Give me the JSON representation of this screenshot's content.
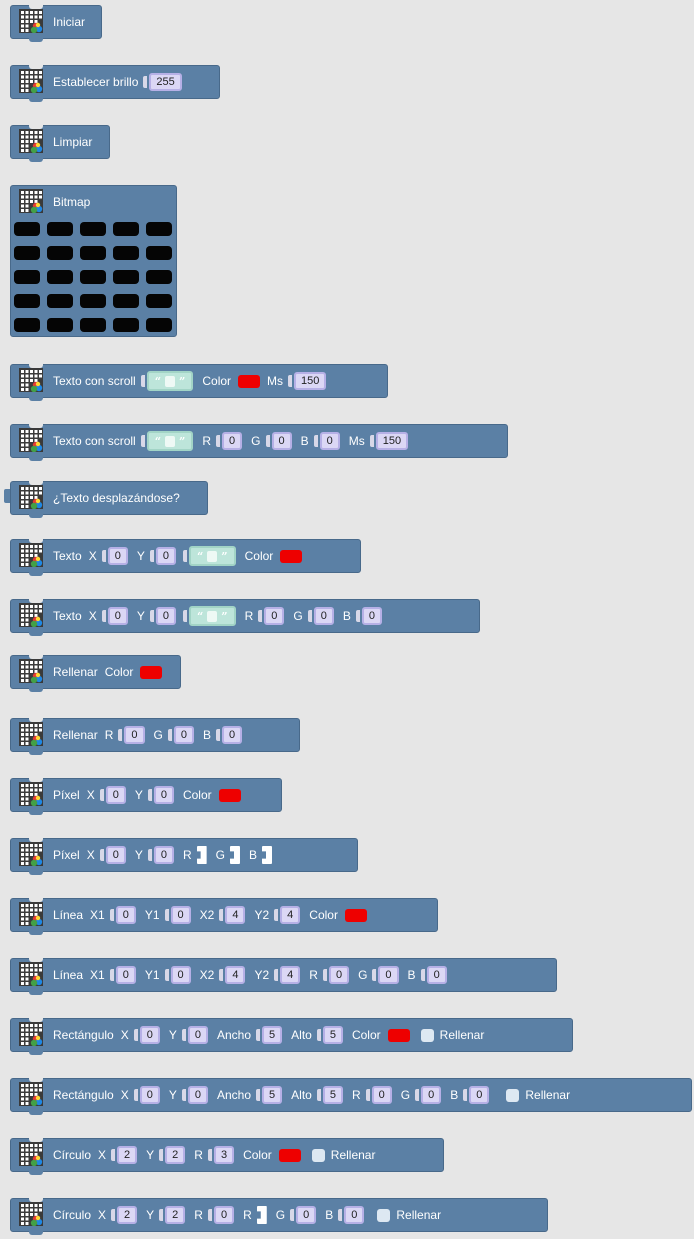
{
  "blocks": {
    "iniciar": {
      "label": "Iniciar"
    },
    "brillo": {
      "label": "Establecer brillo",
      "value": "255"
    },
    "limpiar": {
      "label": "Limpiar"
    },
    "bitmap": {
      "label": "Bitmap",
      "cells": 25
    },
    "scroll1": {
      "label": "Texto con scroll",
      "color_label": "Color",
      "ms_label": "Ms",
      "ms": "150"
    },
    "scroll2": {
      "label": "Texto con scroll",
      "r_label": "R",
      "r": "0",
      "g_label": "G",
      "g": "0",
      "b_label": "B",
      "b": "0",
      "ms_label": "Ms",
      "ms": "150"
    },
    "scrolling": {
      "label": "¿Texto desplazándose?"
    },
    "texto1": {
      "label": "Texto",
      "x_label": "X",
      "x": "0",
      "y_label": "Y",
      "y": "0",
      "color_label": "Color"
    },
    "texto2": {
      "label": "Texto",
      "x_label": "X",
      "x": "0",
      "y_label": "Y",
      "y": "0",
      "r_label": "R",
      "r": "0",
      "g_label": "G",
      "g": "0",
      "b_label": "B",
      "b": "0"
    },
    "rellenar1": {
      "label": "Rellenar",
      "color_label": "Color"
    },
    "rellenar2": {
      "label": "Rellenar",
      "r_label": "R",
      "r": "0",
      "g_label": "G",
      "g": "0",
      "b_label": "B",
      "b": "0"
    },
    "pixel1": {
      "label": "Píxel",
      "x_label": "X",
      "x": "0",
      "y_label": "Y",
      "y": "0",
      "color_label": "Color"
    },
    "pixel2": {
      "label": "Píxel",
      "x_label": "X",
      "x": "0",
      "y_label": "Y",
      "y": "0",
      "r_label": "R",
      "g_label": "G",
      "b_label": "B"
    },
    "linea1": {
      "label": "Línea",
      "x1_label": "X1",
      "x1": "0",
      "y1_label": "Y1",
      "y1": "0",
      "x2_label": "X2",
      "x2": "4",
      "y2_label": "Y2",
      "y2": "4",
      "color_label": "Color"
    },
    "linea2": {
      "label": "Línea",
      "x1_label": "X1",
      "x1": "0",
      "y1_label": "Y1",
      "y1": "0",
      "x2_label": "X2",
      "x2": "4",
      "y2_label": "Y2",
      "y2": "4",
      "r_label": "R",
      "r": "0",
      "g_label": "G",
      "g": "0",
      "b_label": "B",
      "b": "0"
    },
    "rect1": {
      "label": "Rectángulo",
      "x_label": "X",
      "x": "0",
      "y_label": "Y",
      "y": "0",
      "ancho_label": "Ancho",
      "ancho": "5",
      "alto_label": "Alto",
      "alto": "5",
      "color_label": "Color",
      "fill_label": "Rellenar"
    },
    "rect2": {
      "label": "Rectángulo",
      "x_label": "X",
      "x": "0",
      "y_label": "Y",
      "y": "0",
      "ancho_label": "Ancho",
      "ancho": "5",
      "alto_label": "Alto",
      "alto": "5",
      "r_label": "R",
      "r": "0",
      "g_label": "G",
      "g": "0",
      "b_label": "B",
      "b": "0",
      "fill_label": "Rellenar"
    },
    "circ1": {
      "label": "Círculo",
      "x_label": "X",
      "x": "2",
      "y_label": "Y",
      "y": "2",
      "r_label": "R",
      "r": "3",
      "color_label": "Color",
      "fill_label": "Rellenar"
    },
    "circ2": {
      "label": "Círculo",
      "x_label": "X",
      "x": "2",
      "y_label": "Y",
      "y": "2",
      "r_label": "R",
      "r": "0",
      "r2_label": "R",
      "g_label": "G",
      "g": "0",
      "b_label": "B",
      "b": "0",
      "fill_label": "Rellenar"
    }
  },
  "colors": {
    "block": "#5b80a5",
    "swatch": "#ee0000",
    "background": "#e6e6e6"
  },
  "icons": {
    "block_icon": "led-matrix-icon"
  }
}
